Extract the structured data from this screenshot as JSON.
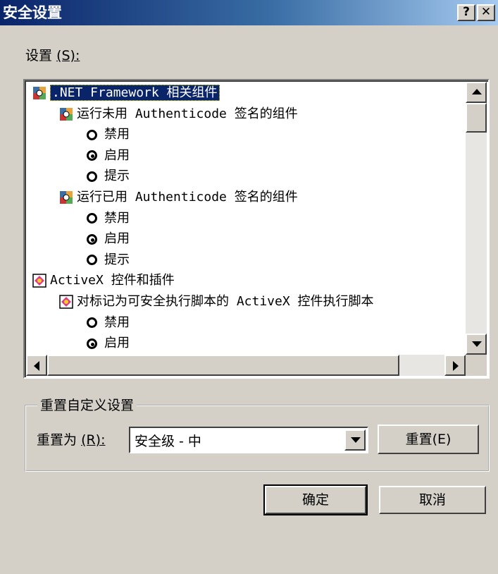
{
  "window": {
    "title": "安全设置",
    "help_glyph": "?",
    "close_glyph": "✕"
  },
  "settings_label": "设置",
  "settings_mnemonic": "(S):",
  "tree": [
    {
      "icon": "dotnet-gear-icon",
      "text": ".NET Framework 相关组件",
      "level": 0,
      "selected": true
    },
    {
      "icon": "dotnet-gear-icon",
      "text": "运行未用 Authenticode 签名的组件",
      "level": 1
    },
    {
      "radio": false,
      "text": "禁用",
      "level": 2
    },
    {
      "radio": true,
      "text": "启用",
      "level": 2
    },
    {
      "radio": false,
      "text": "提示",
      "level": 2
    },
    {
      "icon": "dotnet-gear-icon",
      "text": "运行已用 Authenticode 签名的组件",
      "level": 1
    },
    {
      "radio": false,
      "text": "禁用",
      "level": 2
    },
    {
      "radio": true,
      "text": "启用",
      "level": 2
    },
    {
      "radio": false,
      "text": "提示",
      "level": 2
    },
    {
      "icon": "activex-icon",
      "text": "ActiveX 控件和插件",
      "level": 0
    },
    {
      "icon": "activex-icon",
      "text": "对标记为可安全执行脚本的 ActiveX 控件执行脚本",
      "level": 1
    },
    {
      "radio": false,
      "text": "禁用",
      "level": 2
    },
    {
      "radio": true,
      "text": "启用",
      "level": 2
    }
  ],
  "reset_group": {
    "legend": "重置自定义设置",
    "reset_to_label": "重置为",
    "reset_to_mnemonic": "(R):",
    "combo_value": "安全级 - 中",
    "reset_button": "重置(E)"
  },
  "buttons": {
    "ok": "确定",
    "cancel": "取消"
  },
  "colors": {
    "titlebar_start": "#0a246a",
    "titlebar_end": "#a6caf0",
    "face": "#d4d0c8"
  }
}
